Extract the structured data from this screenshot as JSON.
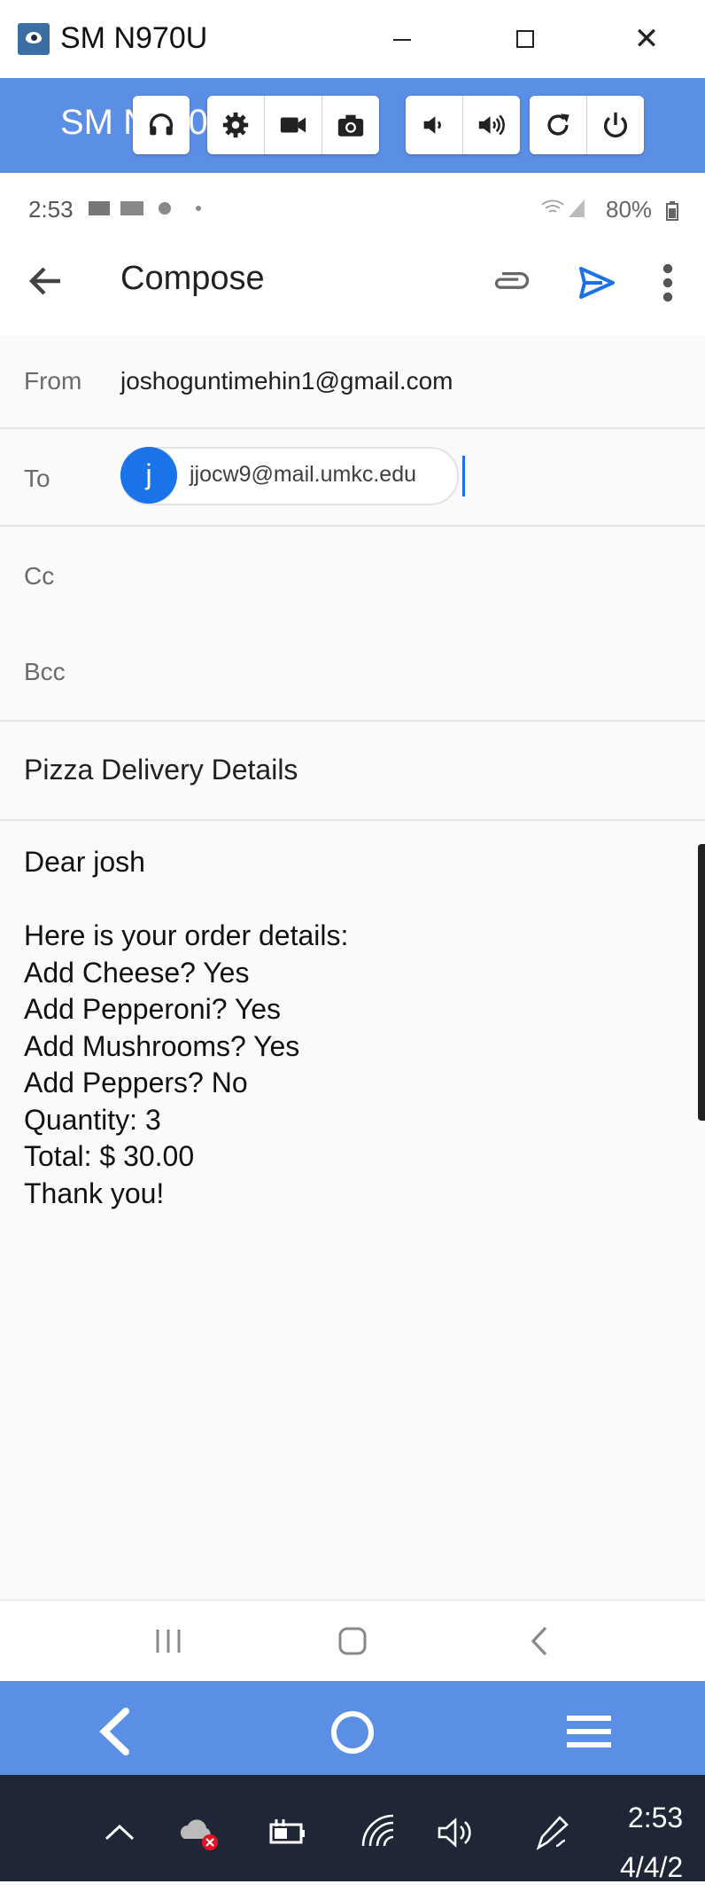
{
  "window": {
    "title": "SM N970U",
    "minimize_label": "",
    "maximize_label": "",
    "close_label": "✕"
  },
  "toolbar": {
    "device_name": "SM N970U",
    "buttons": [
      "headphones-icon",
      "gear-icon",
      "video-camera-icon",
      "camera-icon",
      "volume-down-icon",
      "volume-up-icon",
      "rotate-icon",
      "power-icon"
    ]
  },
  "status_bar": {
    "time": "2:53",
    "battery": "80%"
  },
  "compose": {
    "title": "Compose",
    "from_label": "From",
    "from_value": "joshoguntimehin1@gmail.com",
    "to_label": "To",
    "to_avatar_letter": "j",
    "to_value": "jjocw9@mail.umkc.edu",
    "cc_label": "Cc",
    "bcc_label": "Bcc",
    "subject": "Pizza Delivery Details",
    "body_lines": [
      "Dear josh",
      "",
      "Here is your order details:",
      "Add Cheese? Yes",
      "Add Pepperoni? Yes",
      "Add Mushrooms? Yes",
      "Add Peppers? No",
      "Quantity: 3",
      "Total: $ 30.00",
      "Thank you!"
    ]
  },
  "taskbar": {
    "clock_time": "2:53",
    "clock_date": "4/4/2"
  },
  "colors": {
    "accent_blue": "#5b8fe6",
    "gmail_blue": "#1a73e8",
    "taskbar": "#1f2737"
  }
}
